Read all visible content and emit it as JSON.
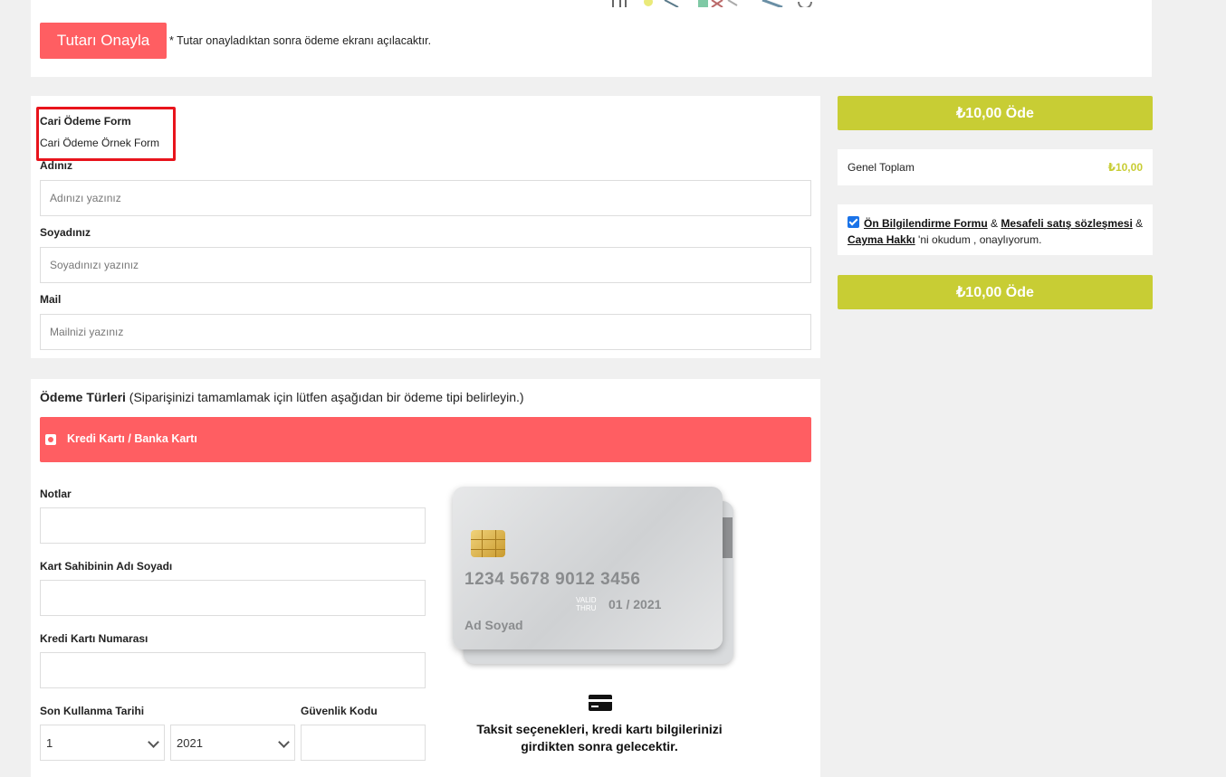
{
  "top": {
    "confirm_button": "Tutarı Onayla",
    "confirm_note": "* Tutar onayladıktan sonra ödeme ekranı açılacaktır."
  },
  "form": {
    "title": "Cari Ödeme Form",
    "subtitle": "Cari Ödeme Örnek Form",
    "fields": {
      "first_name": {
        "label": "Adınız",
        "placeholder": "Adınızı yazınız"
      },
      "last_name": {
        "label": "Soyadınız",
        "placeholder": "Soyadınızı yazınız"
      },
      "email": {
        "label": "Mail",
        "placeholder": "Mailnizi yazınız"
      }
    }
  },
  "payment": {
    "title_bold": "Ödeme Türleri",
    "title_rest": " (Siparişinizi tamamlamak için lütfen aşağıdan bir ödeme tipi belirleyin.)",
    "option_label": "Kredi Kartı / Banka Kartı",
    "notes_label": "Notlar",
    "holder_label": "Kart Sahibinin Adı Soyadı",
    "card_number_label": "Kredi Kartı Numarası",
    "expiry_label": "Son Kullanma Tarihi",
    "cvc_label": "Güvenlik Kodu",
    "month_value": "1",
    "year_value": "2021",
    "card": {
      "number": "1234 5678 9012 3456",
      "valid_line1": "VALID",
      "valid_line2": "THRU",
      "expiry": "01 / 2021",
      "name": "Ad Soyad"
    },
    "installment_line1": "Taksit seçenekleri, kredi kartı bilgilerinizi",
    "installment_line2": "girdikten sonra gelecektir."
  },
  "summary": {
    "pay_button": "₺10,00 Öde",
    "total_label": "Genel Toplam",
    "total_value": "₺10,00",
    "agree": {
      "link1": "Ön Bilgilendirme Formu",
      "sep1": " & ",
      "link2": "Mesafeli satış sözleşmesi",
      "sep2": " & ",
      "link3": "Cayma Hakkı",
      "rest": " 'ni okudum , onaylıyorum."
    }
  },
  "colors": {
    "accent_red": "#ff5e62",
    "pay_green": "#c8cd34",
    "highlight_box": "#e8141c"
  }
}
